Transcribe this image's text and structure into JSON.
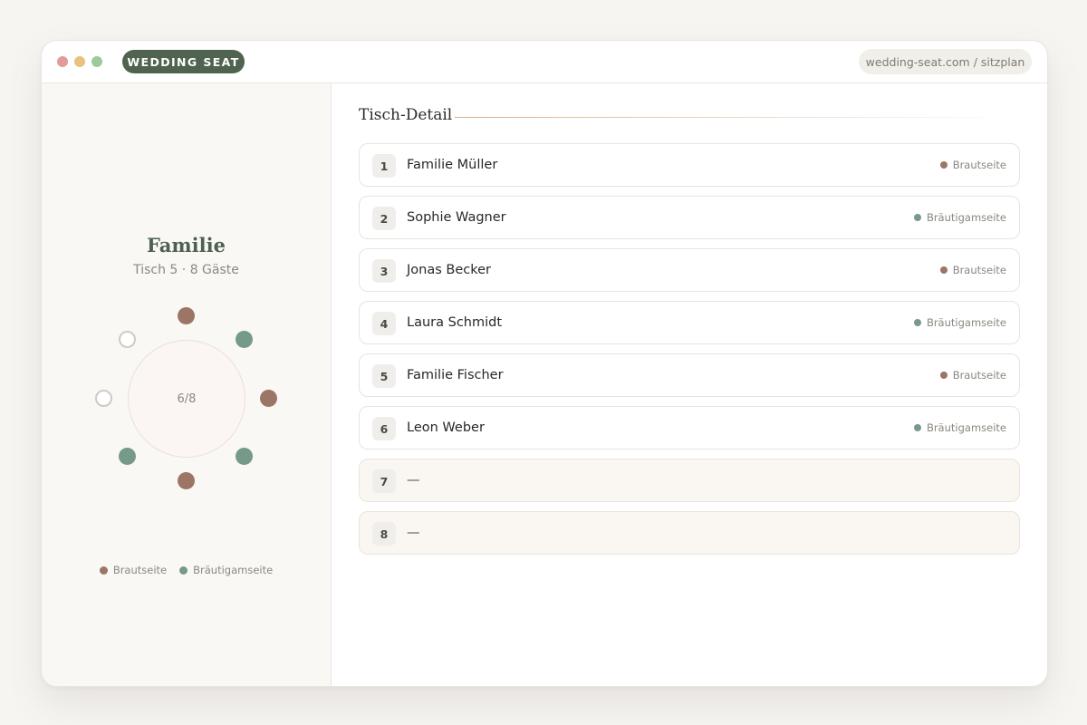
{
  "colors": {
    "bride_side": "#9c7566",
    "groom_side": "#759a8a",
    "empty_seat": "#ffffff",
    "accent": "#4f6350"
  },
  "window": {
    "dots": [
      "#e39a9a",
      "#e8c27e",
      "#9fc99a"
    ],
    "brand": "WEDDING SEAT",
    "url": "wedding-seat.com / sitzplan"
  },
  "table": {
    "name": "Familie",
    "subtitle": "Tisch 5 · 8 Gäste",
    "occupancy": "6/8",
    "seats": [
      "bride",
      "groom",
      "bride",
      "groom",
      "bride",
      "groom",
      "empty",
      "empty"
    ]
  },
  "legend": {
    "bride": "Brautseite",
    "groom": "Bräutigamseite"
  },
  "detail": {
    "title": "Tisch-Detail",
    "rows": [
      {
        "num": "1",
        "name": "Familie Müller",
        "side": "bride",
        "side_label": "Brautseite"
      },
      {
        "num": "2",
        "name": "Sophie Wagner",
        "side": "groom",
        "side_label": "Bräutigamseite"
      },
      {
        "num": "3",
        "name": "Jonas Becker",
        "side": "bride",
        "side_label": "Brautseite"
      },
      {
        "num": "4",
        "name": "Laura Schmidt",
        "side": "groom",
        "side_label": "Bräutigamseite"
      },
      {
        "num": "5",
        "name": "Familie Fischer",
        "side": "bride",
        "side_label": "Brautseite"
      },
      {
        "num": "6",
        "name": "Leon Weber",
        "side": "groom",
        "side_label": "Bräutigamseite"
      },
      {
        "num": "7",
        "name": "—",
        "side": "empty",
        "side_label": ""
      },
      {
        "num": "8",
        "name": "—",
        "side": "empty",
        "side_label": ""
      }
    ]
  }
}
